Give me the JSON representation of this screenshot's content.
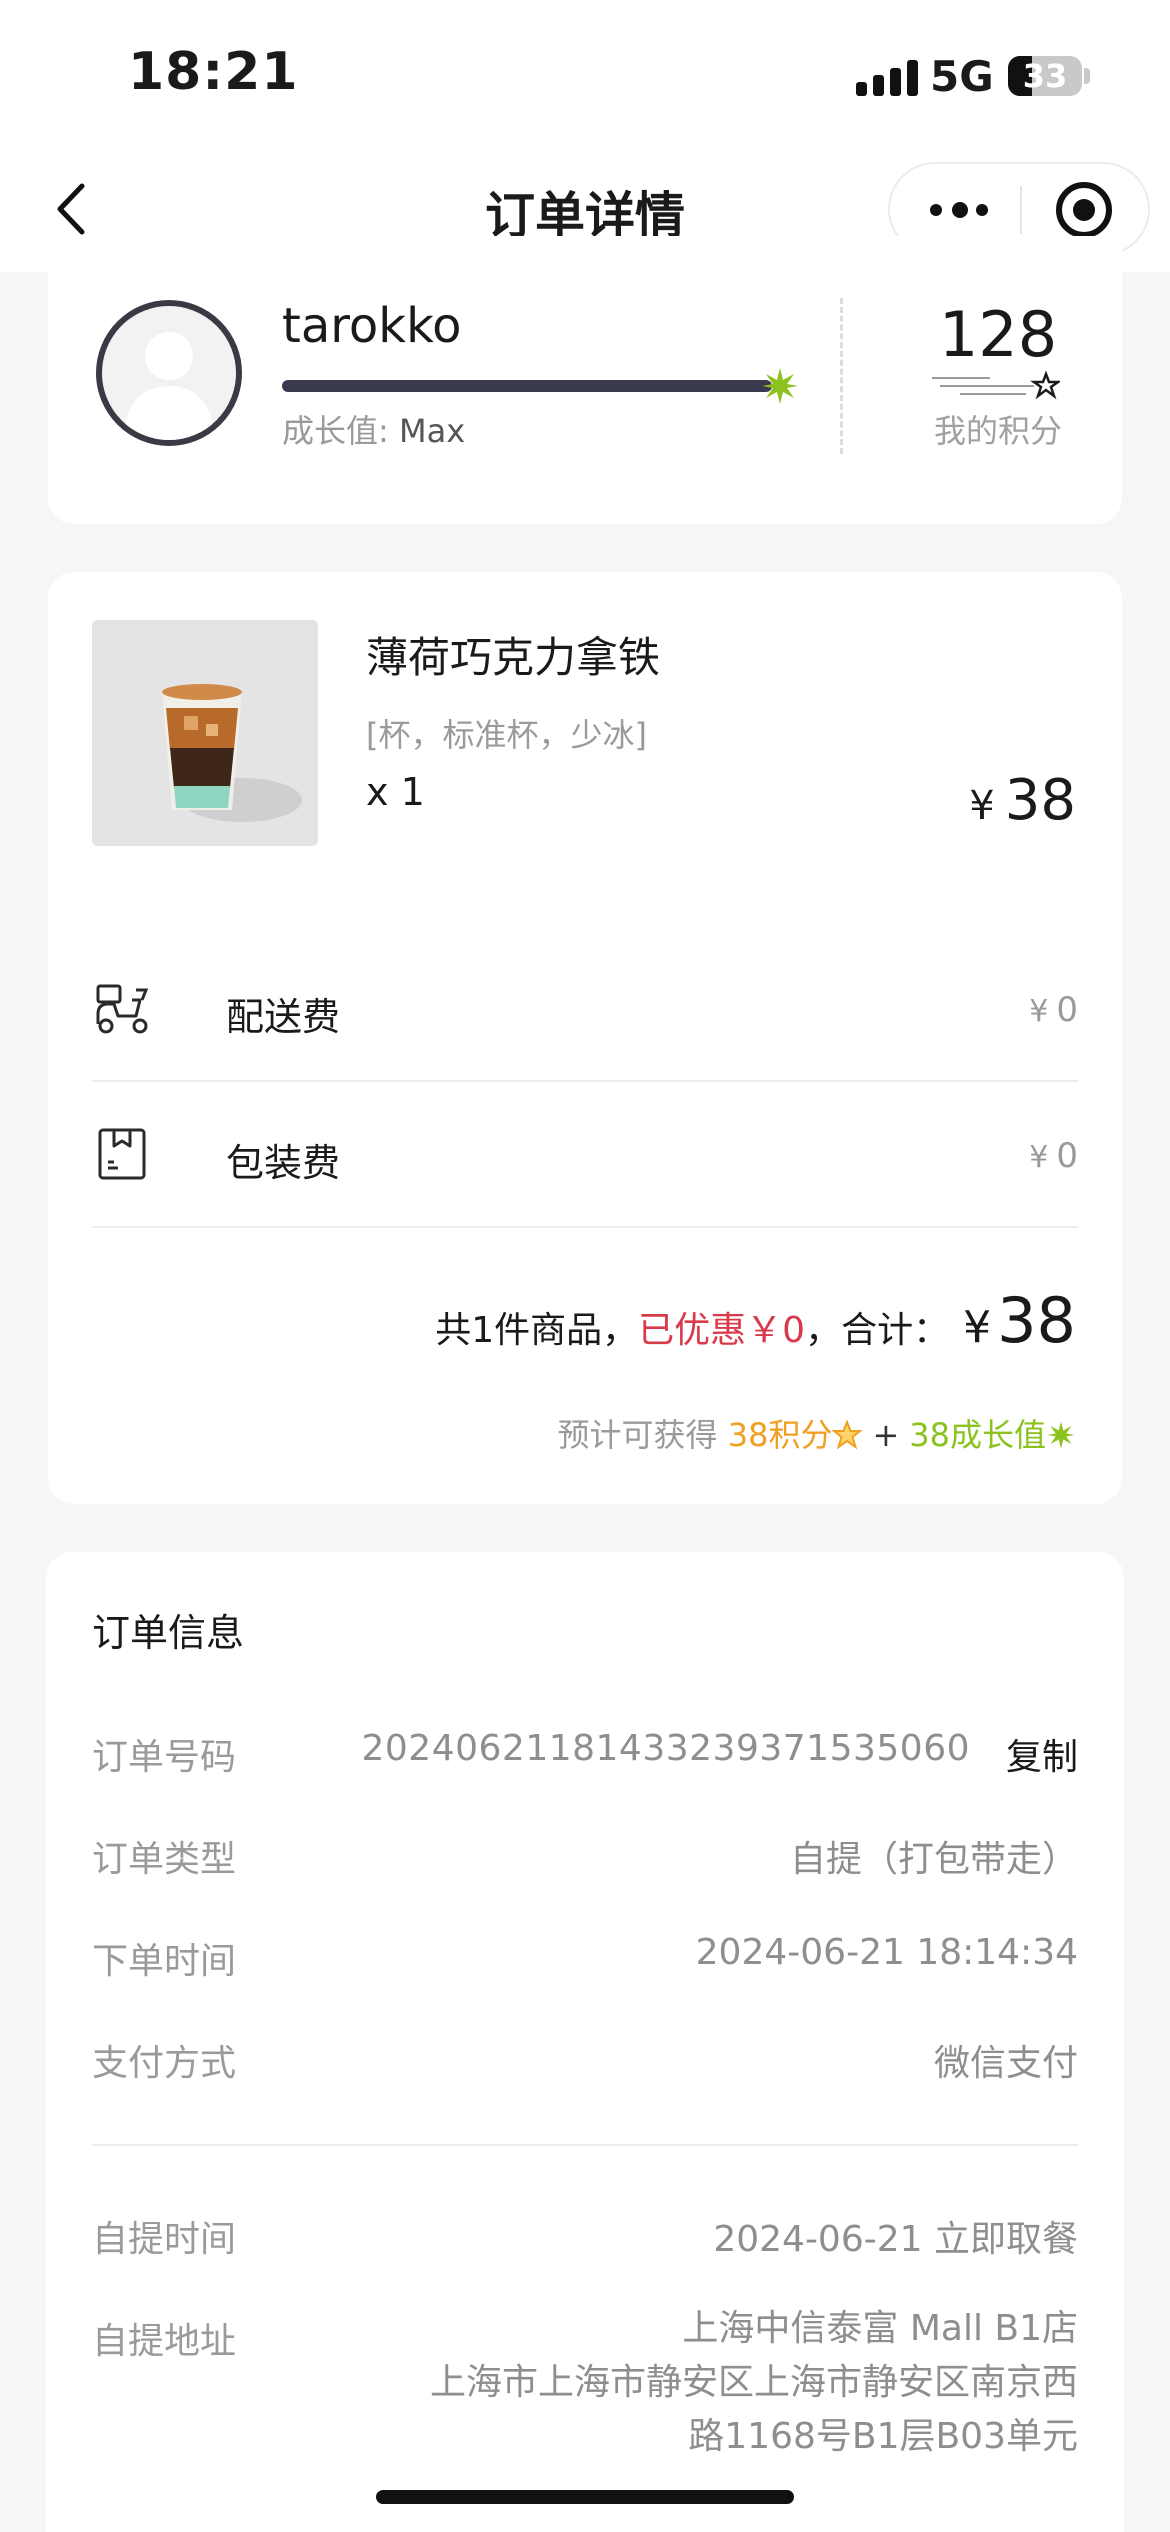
{
  "status_bar": {
    "time": "18:21",
    "network": "5G",
    "battery": "33",
    "battery_level": 0.33
  },
  "nav": {
    "title": "订单详情"
  },
  "profile": {
    "username": "tarokko",
    "growth_prefix": "成长值:",
    "growth_value": "Max",
    "growth_progress": 1.0,
    "points_value": "128",
    "points_label": "我的积分"
  },
  "product": {
    "name": "薄荷巧克力拿铁",
    "spec": "[杯，标准杯，少冰]",
    "quantity": "x 1",
    "currency": "¥",
    "price": "38"
  },
  "fees": [
    {
      "icon": "scooter-icon",
      "label": "配送费",
      "currency": "¥",
      "value": "0"
    },
    {
      "icon": "package-icon",
      "label": "包装费",
      "currency": "¥",
      "value": "0"
    }
  ],
  "summary": {
    "count_text": "共1件商品，",
    "discount_text": "已优惠￥0",
    "total_prefix": "，合计：",
    "currency": "¥",
    "total": "38"
  },
  "estimate": {
    "prefix": "预计可获得",
    "points": "38积分",
    "plus": "+",
    "growth": "38成长值"
  },
  "order_info": {
    "title": "订单信息",
    "copy_label": "复制",
    "rows": [
      {
        "key": "订单号码",
        "value": "2024062118143323937153506​0"
      },
      {
        "key": "订单类型",
        "value": "自提（打包带走）"
      },
      {
        "key": "下单时间",
        "value": "2024-06-21 18:14:34"
      },
      {
        "key": "支付方式",
        "value": "微信支付"
      }
    ],
    "pickup_rows": [
      {
        "key": "自提时间",
        "value": "2024-06-21 立即取餐"
      }
    ],
    "address": {
      "key": "自提地址",
      "lines": [
        "上海中信泰富 Mall B1店",
        "上海市上海市静安区上海市静安区南京西",
        "路1168号B1层B03单元"
      ]
    }
  },
  "colors": {
    "accent_red": "#d93a4a",
    "points_orange": "#f0a020",
    "growth_green": "#8cc21f"
  }
}
